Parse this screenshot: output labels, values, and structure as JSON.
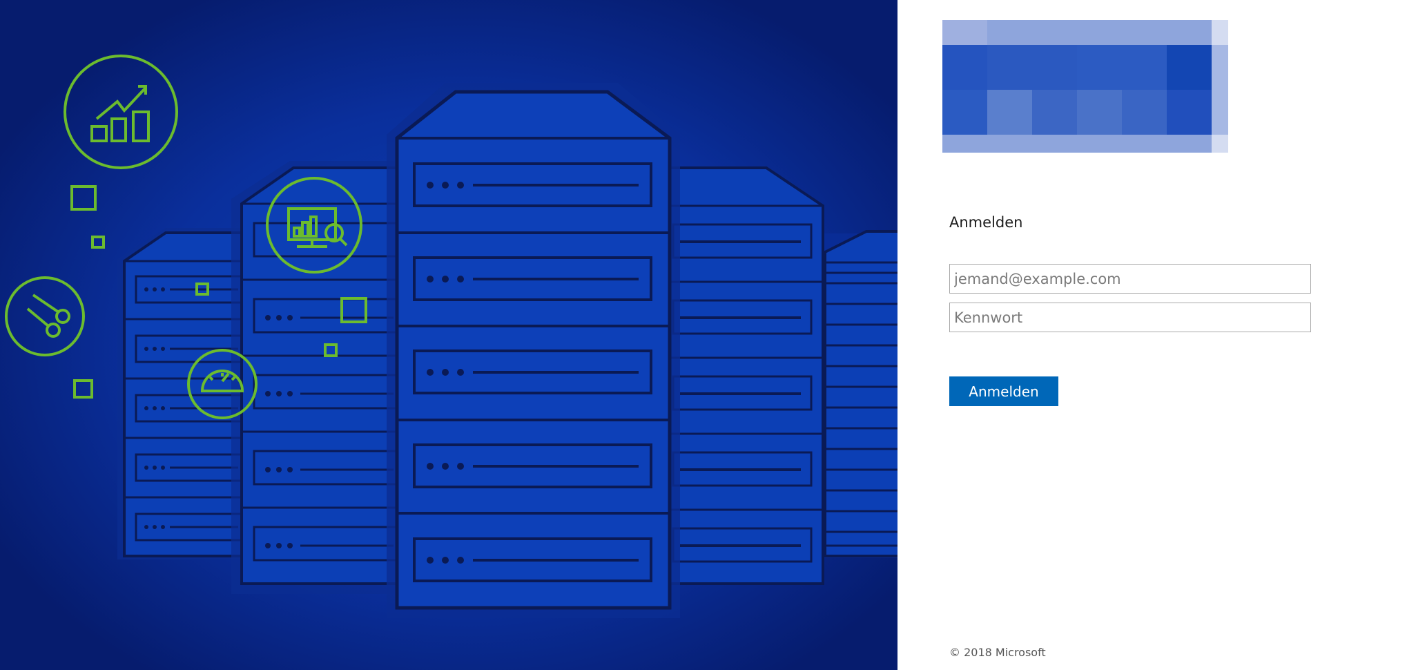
{
  "colors": {
    "illustration_bg": "#0a2fa0",
    "server_fill": "#0c3fb5",
    "server_outline": "#0a1a55",
    "accent_green": "#6cbc2e",
    "button_bg": "#0067b8"
  },
  "illustration": {
    "icons": [
      "growth-chart-icon",
      "scissors-icon",
      "monitor-search-icon",
      "speedometer-icon"
    ]
  },
  "logo": {
    "kind": "pixelated-placeholder"
  },
  "signin": {
    "heading": "Anmelden",
    "email_placeholder": "jemand@example.com",
    "password_placeholder": "Kennwort",
    "submit_label": "Anmelden"
  },
  "footer": {
    "copyright": "© 2018 Microsoft"
  }
}
